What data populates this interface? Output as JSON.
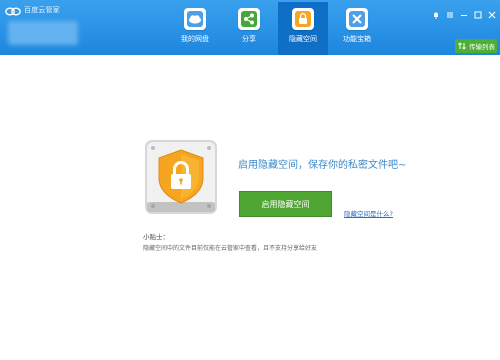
{
  "window": {
    "title": "百度云管家"
  },
  "nav": {
    "items": [
      {
        "label": "我的网盘",
        "icon": "cloud-icon",
        "color": "#3c8fe0"
      },
      {
        "label": "分享",
        "icon": "share-icon",
        "color": "#3fa535"
      },
      {
        "label": "隐藏空间",
        "icon": "lock-icon",
        "color": "#f5a623"
      },
      {
        "label": "功能宝箱",
        "icon": "tools-icon",
        "color": "#3c8fe0"
      }
    ],
    "active_index": 2
  },
  "window_controls": [
    "bell-icon",
    "menu-icon",
    "minimize-icon",
    "maximize-icon",
    "close-icon"
  ],
  "transfer": {
    "label": "传输列表",
    "color": "#4fae35"
  },
  "main": {
    "headline": "启用隐藏空间，保存你的私密文件吧~",
    "enable_button": "启用隐藏空间",
    "what_link": "隐藏空间是什么?",
    "tip_title": "小贴士：",
    "tip_text": "隐藏空间中的文件目前仅能在云管家中查看，且不支持分享给好友"
  },
  "colors": {
    "topbar": "#1d86de",
    "accent_green": "#4fa532",
    "link": "#2a6fc1",
    "headline": "#3d88c8"
  }
}
